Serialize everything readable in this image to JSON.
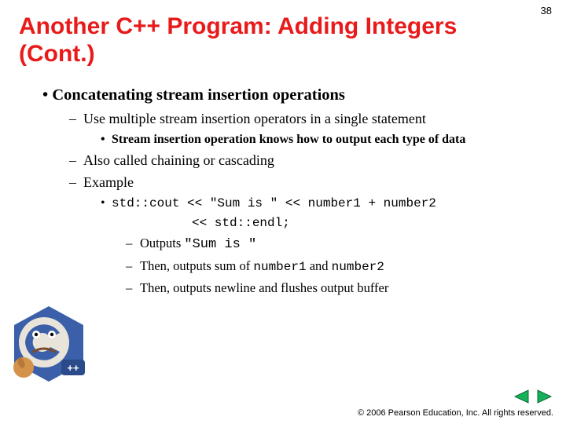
{
  "page_number": "38",
  "title": "Another C++ Program: Adding Integers (Cont.)",
  "bullets": {
    "l1": "Concatenating stream insertion operations",
    "l2a": "Use multiple stream insertion operators in a single statement",
    "l3a": "Stream insertion operation knows how to output each type of data",
    "l2b": "Also called chaining or cascading",
    "l2c": "Example",
    "code_line1": "std::cout << \"Sum is \" << number1 + number2",
    "code_line2": "<< std::endl;",
    "sub1_prefix": "Outputs ",
    "sub1_code": "\"Sum is \"",
    "sub2_prefix": "Then, outputs sum of ",
    "sub2_code1": "number1",
    "sub2_mid": " and ",
    "sub2_code2": "number2",
    "sub3": "Then, outputs newline and flushes output buffer"
  },
  "copyright": "© 2006 Pearson Education, Inc.  All rights reserved."
}
